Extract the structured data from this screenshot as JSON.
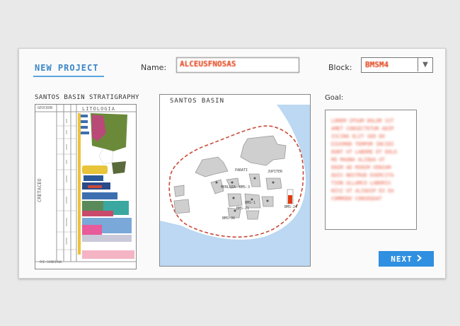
{
  "header": {
    "title": "NEW PROJECT",
    "name_label": "Name:",
    "name_value": "ALCEUSFNOSAS",
    "block_label": "Block:",
    "block_value": "BMSM4"
  },
  "stratigraphy": {
    "title": "SANTOS BASIN STRATIGRAPHY",
    "col_header_left": "GEOCRON",
    "col_header_right": "LITOLOGIA",
    "period_label": "CRETACEO",
    "footer": "PRÉ-CAMBRIANO"
  },
  "map": {
    "title": "SANTOS BASIN",
    "labels": [
      "PARATI",
      "JUPITER",
      "MERLUZA",
      "BMS-3",
      "BMS-21",
      "BMS-36",
      "BMS-24",
      "BMS-1"
    ]
  },
  "goal": {
    "label": "Goal:",
    "text": "LOREM IPSUM DOLOR SIT\nAMET CONSECTETUR ADIP\nISCING ELIT SED DO\nEIUSMOD TEMPOR INCIDI\nDUNT UT LABORE ET DOLO\nRE MAGNA ALIQUA UT\nENIM AD MINIM VENIAM\nQUIS NOSTRUD EXERCITA\nTION ULLAMCO LABORIS\nNISI UT ALIQUIP EX EA\nCOMMODO CONSEQUAT"
  },
  "actions": {
    "next_label": "NEXT"
  },
  "colors": {
    "accent": "#2f8fe0",
    "redacted": "#e23a10",
    "dashed_border": "#c94a3a",
    "sea": "#bcd8f2"
  },
  "icons": {
    "dropdown": "triangle-down-icon",
    "next": "chevron-right-icon"
  }
}
